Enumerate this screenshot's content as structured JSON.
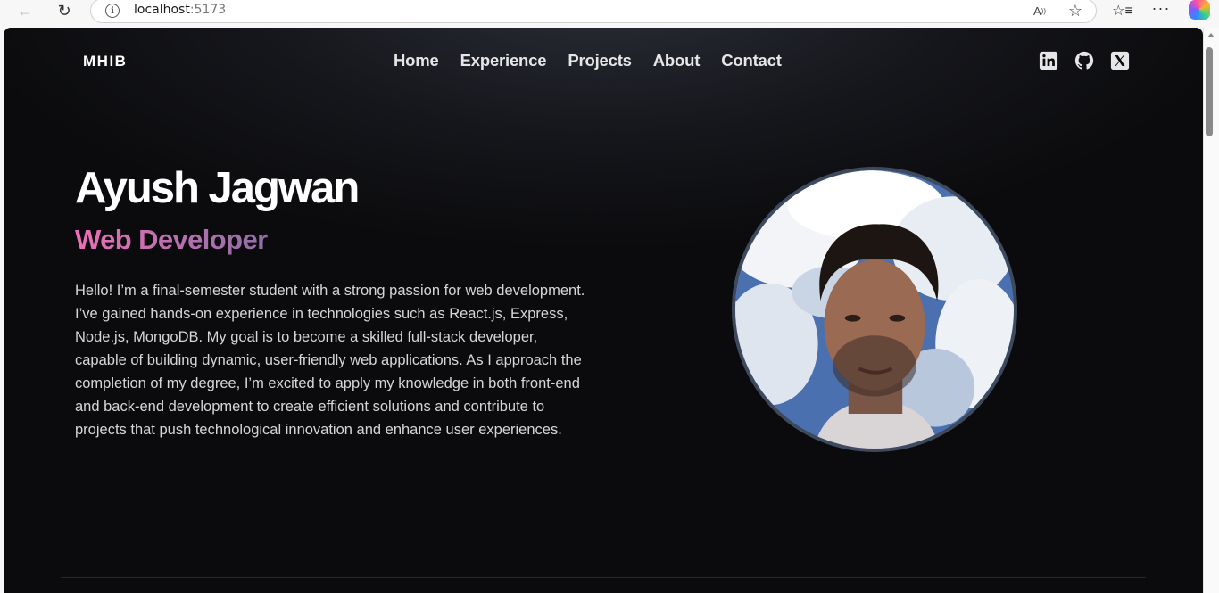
{
  "browser": {
    "url_host": "localhost",
    "url_port": ":5173",
    "icons": {
      "back": "arrow-left-icon",
      "reload": "reload-icon",
      "info": "info-icon",
      "read_aloud": "read-aloud-icon",
      "favorite": "star-icon",
      "favorites": "favorites-icon",
      "more": "more-icon",
      "copilot": "copilot-icon"
    }
  },
  "site": {
    "logo": "MHIB",
    "nav": [
      {
        "label": "Home"
      },
      {
        "label": "Experience"
      },
      {
        "label": "Projects"
      },
      {
        "label": "About"
      },
      {
        "label": "Contact"
      }
    ],
    "socials": [
      "linkedin-icon",
      "github-icon",
      "x-icon"
    ]
  },
  "hero": {
    "name": "Ayush Jagwan",
    "role": "Web Developer",
    "bio": "Hello! I’m a final-semester student with a strong passion for web development. I’ve gained hands-on experience in technologies such as React.js, Express, Node.js, MongoDB. My goal is to become a skilled full-stack developer, capable of building dynamic, user-friendly web applications. As I approach the completion of my degree, I’m excited to apply my knowledge in both front-end and back-end development to create efficient solutions and contribute to projects that push technological innovation and enhance user experiences."
  },
  "colors": {
    "background": "#0b0b0d",
    "role_gradient_start": "#ec6fb6",
    "role_gradient_end": "#8f6fa8",
    "avatar_border": "#3d4a5e"
  }
}
